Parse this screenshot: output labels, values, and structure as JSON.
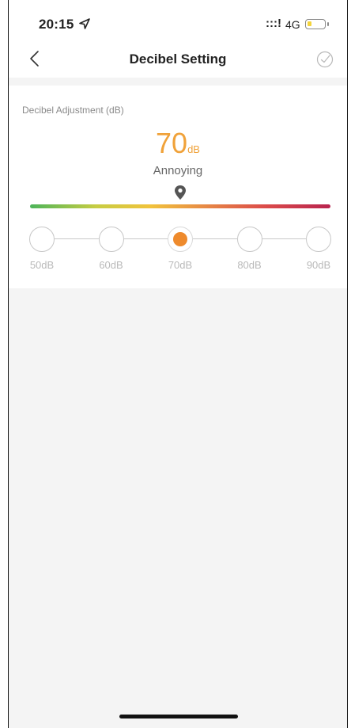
{
  "status_bar": {
    "time": "20:15",
    "signal": ":::!",
    "network": "4G",
    "battery_level": 0.25
  },
  "nav": {
    "title": "Decibel Setting",
    "back_icon": "chevron-left-icon",
    "confirm_icon": "check-circle-icon"
  },
  "adjustment": {
    "label": "Decibel Adjustment (dB)",
    "value": "70",
    "unit": "dB",
    "description": "Annoying",
    "accent_color": "#f0a23a",
    "gradient_colors": [
      "#4cb45a",
      "#f1c33c",
      "#e78a45",
      "#b8244f"
    ]
  },
  "steps": [
    {
      "label": "50dB",
      "selected": false
    },
    {
      "label": "60dB",
      "selected": false
    },
    {
      "label": "70dB",
      "selected": true
    },
    {
      "label": "80dB",
      "selected": false
    },
    {
      "label": "90dB",
      "selected": false
    }
  ]
}
